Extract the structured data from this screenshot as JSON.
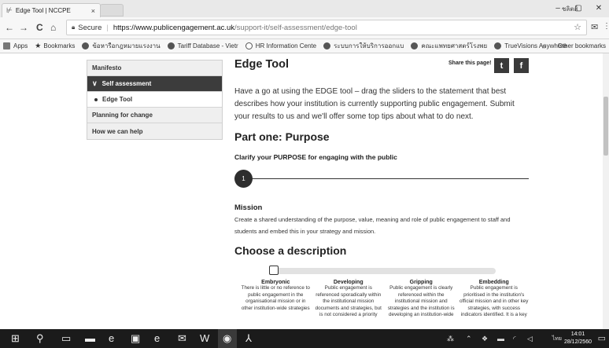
{
  "browser": {
    "tab_title": "Edge Tool | NCCPE",
    "tab_close": "×",
    "user_label": "ชลิตส์",
    "window_controls": {
      "minimize": "–",
      "maximize": "▢",
      "close": "✕"
    },
    "nav": {
      "back": "←",
      "forward": "→",
      "reload": "C",
      "home": "⌂"
    },
    "address": {
      "secure_label": "Secure",
      "host": "https://www.publicengagement.ac.uk",
      "path": "/support-it/self-assessment/edge-tool",
      "star": "☆"
    },
    "bookmarks": [
      {
        "label": "Apps",
        "icon": "apps-grid-icon"
      },
      {
        "label": "Bookmarks",
        "icon": "star-icon"
      },
      {
        "label": "ข้อหารือกฎหมายแรงงาน",
        "icon": "site-icon"
      },
      {
        "label": "Tariff Database - Vietr",
        "icon": "site-icon"
      },
      {
        "label": "HR Information Cente",
        "icon": "google-icon"
      },
      {
        "label": "ระบบการให้บริการออกแบ",
        "icon": "site-icon"
      },
      {
        "label": "คณะแพทยศาสตร์โรงพย",
        "icon": "site-icon"
      },
      {
        "label": "TrueVisions Anywhere",
        "icon": "site-icon"
      }
    ],
    "bookmarks_more": "»",
    "other_bookmarks": "Other bookmarks"
  },
  "sidebar": {
    "items": [
      {
        "label": "Manifesto"
      },
      {
        "label": "Self assessment",
        "chevron": "∨"
      },
      {
        "label": "Edge Tool"
      },
      {
        "label": "Planning for change"
      },
      {
        "label": "How we can help"
      }
    ]
  },
  "main": {
    "title": "Edge Tool",
    "share_label": "Share this page!",
    "share_twitter": "t",
    "share_facebook": "f",
    "intro": "Have a go at using the EDGE tool – drag the sliders to the statement that best describes how your institution is currently supporting public engagement. Submit your results to us and we'll offer some top tips about what to do next.",
    "part_title": "Part one: Purpose",
    "clarify": "Clarify your PURPOSE for engaging with the public",
    "step_number": "1",
    "mission_title": "Mission",
    "mission_text": "Create a shared understanding of the purpose, value, meaning and role of public engagement to staff and students and embed this in your strategy and mission.",
    "choose_title": "Choose a description",
    "slider_level": 0,
    "choices": [
      {
        "title": "Embryonic",
        "desc": "There is little or no reference to public engagement in the organisational mission or in other institution-wide strategies"
      },
      {
        "title": "Developing",
        "desc": "Public engagement is referenced sporadically within the institutional mission documents and strategies, but is not considered a priority"
      },
      {
        "title": "Gripping",
        "desc": "Public engagement is clearly referenced within the institutional mission and strategies and the institution is developing an institution-wide"
      },
      {
        "title": "Embedding",
        "desc": "Public engagement is prioritised in the institution's official mission and in other key strategies, with success indicators identified. It is a key"
      }
    ]
  },
  "taskbar": {
    "lang": "ไทย",
    "time": "14:01",
    "date": "28/12/2560"
  }
}
